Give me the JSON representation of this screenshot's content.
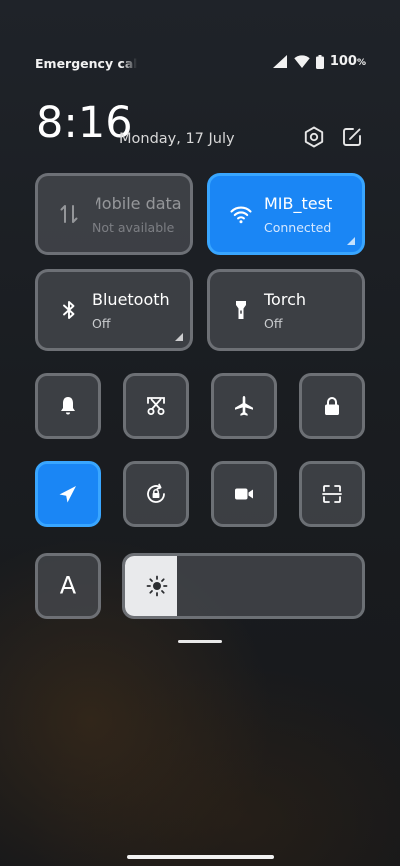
{
  "status_bar": {
    "left_text": "Emergency calls only",
    "battery_value": "100",
    "battery_unit": "%"
  },
  "header": {
    "time": "8:16",
    "date": "Monday, 17 July",
    "icons": [
      "settings-hexagon-icon",
      "edit-icon"
    ]
  },
  "tiles": {
    "mobile_data": {
      "label": "Mobile data",
      "sub": "Not available",
      "state": "disabled"
    },
    "wifi": {
      "label": "MIB_test",
      "sub": "Connected",
      "state": "on"
    },
    "bluetooth": {
      "label": "Bluetooth",
      "sub": "Off",
      "state": "off"
    },
    "torch": {
      "label": "Torch",
      "sub": "Off",
      "state": "off"
    }
  },
  "small_tiles": [
    {
      "name": "notification",
      "icon": "bell-icon",
      "state": "off"
    },
    {
      "name": "screenshot",
      "icon": "scissors-icon",
      "state": "off"
    },
    {
      "name": "airplane-mode",
      "icon": "airplane-icon",
      "state": "off"
    },
    {
      "name": "lock-screen",
      "icon": "lock-icon",
      "state": "off"
    },
    {
      "name": "location",
      "icon": "location-arrow-icon",
      "state": "on"
    },
    {
      "name": "auto-rotate",
      "icon": "rotation-lock-icon",
      "state": "off"
    },
    {
      "name": "screen-recorder",
      "icon": "video-camera-icon",
      "state": "off"
    },
    {
      "name": "scanner",
      "icon": "scan-icon",
      "state": "off"
    },
    {
      "name": "font-size",
      "icon": "font-a-icon",
      "label": "A",
      "state": "off"
    }
  ],
  "brightness": {
    "level_fraction": 0.22,
    "icon": "sun-icon"
  },
  "colors": {
    "accent": "#1a86f5",
    "accent_border": "#39a6ff",
    "tile_bg": "#484b50",
    "tile_border": "#96999e"
  }
}
